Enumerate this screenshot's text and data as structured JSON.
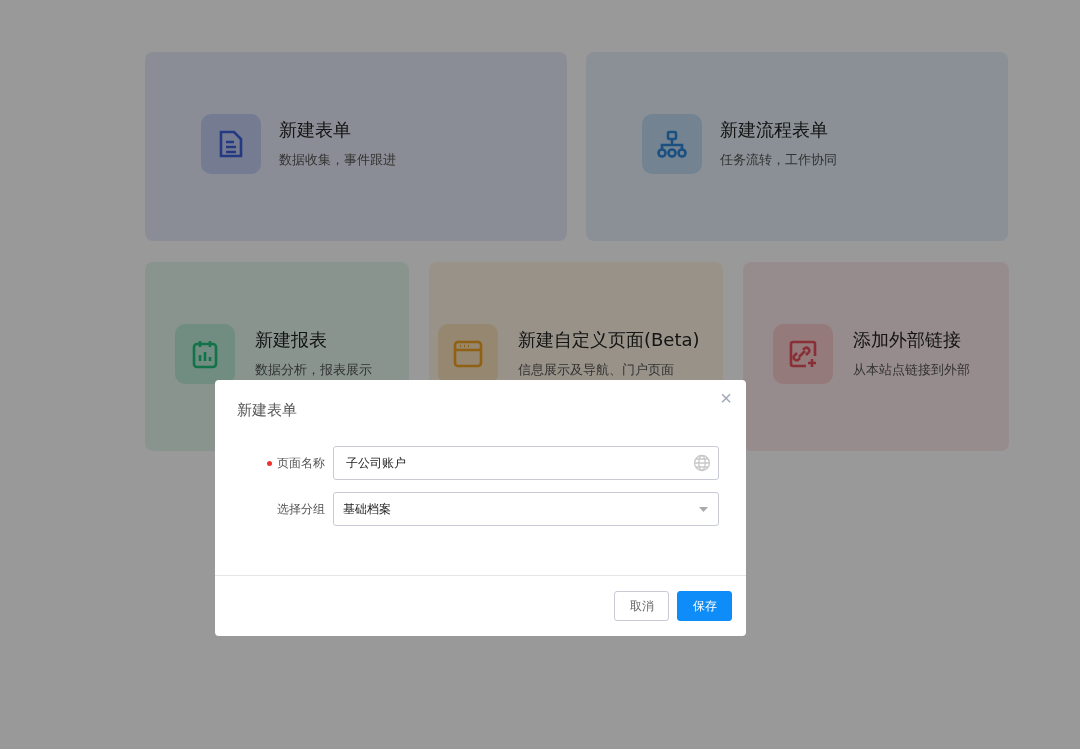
{
  "card_rows": [
    [
      {
        "kind": "form",
        "title": "新建表单",
        "subtitle": "数据收集，事件跟进"
      },
      {
        "kind": "flow",
        "title": "新建流程表单",
        "subtitle": "任务流转，工作协同"
      }
    ],
    [
      {
        "kind": "report",
        "title": "新建报表",
        "subtitle": "数据分析，报表展示"
      },
      {
        "kind": "page",
        "title": "新建自定义页面(Beta)",
        "subtitle": "信息展示及导航、门户页面"
      },
      {
        "kind": "link",
        "title": "添加外部链接",
        "subtitle": "从本站点链接到外部"
      }
    ]
  ],
  "dialog": {
    "title": "新建表单",
    "close": "×",
    "fields": [
      {
        "kind": "text",
        "label": "页面名称",
        "required": true,
        "value": "子公司账户"
      },
      {
        "kind": "select",
        "label": "选择分组",
        "required": false,
        "value": "基础档案"
      }
    ],
    "buttons": [
      {
        "label": "取消",
        "primary": false
      },
      {
        "label": "保存",
        "primary": true
      }
    ]
  }
}
